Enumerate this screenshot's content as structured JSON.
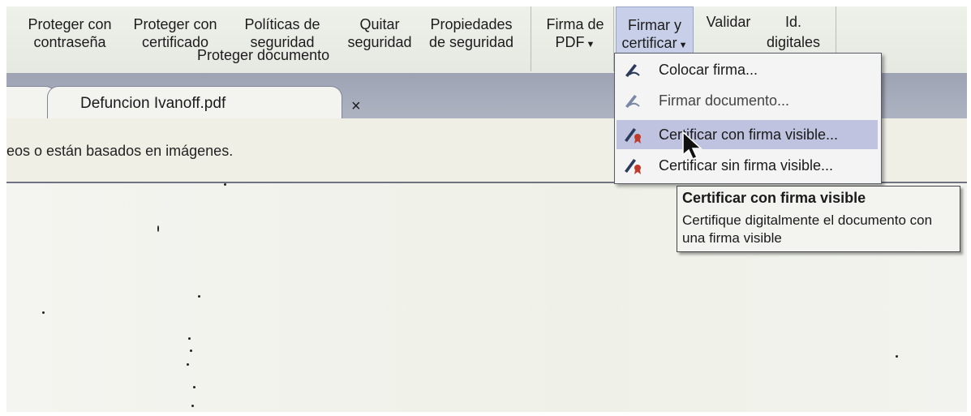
{
  "ribbon": {
    "buttons": [
      {
        "line1": "Proteger con",
        "line2": "contraseña"
      },
      {
        "line1": "Proteger con",
        "line2": "certificado"
      },
      {
        "line1": "Políticas de",
        "line2": "seguridad"
      },
      {
        "line1": "Quitar",
        "line2": "seguridad"
      },
      {
        "line1": "Propiedades",
        "line2": "de seguridad"
      },
      {
        "line1": "Firma de",
        "line2": "PDF"
      },
      {
        "line1": "Firmar y",
        "line2": "certificar"
      },
      {
        "line1": "Validar",
        "line2": ""
      },
      {
        "line1": "Id.",
        "line2": "digitales"
      }
    ],
    "group_label": "Proteger documento"
  },
  "tabs": {
    "active_title": "Defuncion Ivanoff.pdf",
    "close_glyph": "×"
  },
  "infobar": {
    "text": "eos o están basados en imágenes."
  },
  "menu": {
    "items": [
      {
        "label": "Colocar firma...",
        "icon": "pen-sign-icon"
      },
      {
        "label": "Firmar documento...",
        "icon": "pen-sign-icon"
      },
      {
        "label": "Certificar con firma visible...",
        "icon": "certify-visible-icon"
      },
      {
        "label": "Certificar sin firma visible...",
        "icon": "certify-invisible-icon"
      }
    ]
  },
  "tooltip": {
    "title": "Certificar con firma visible",
    "body": "Certifique digitalmente el documento con una firma visible"
  },
  "colors": {
    "menu_highlight": "#bfc3e0",
    "tabstrip": "#a5aabb"
  }
}
